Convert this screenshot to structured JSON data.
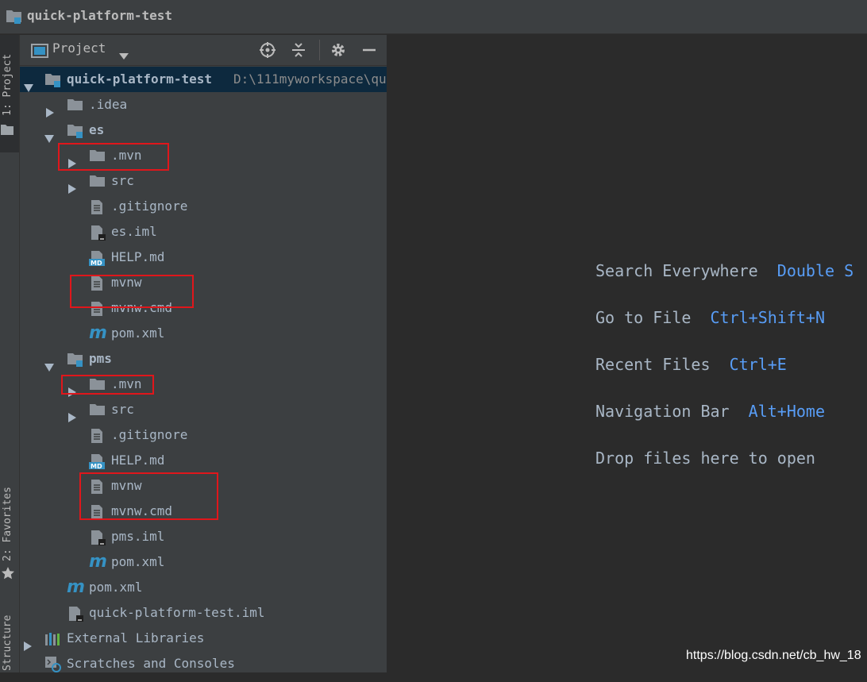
{
  "window": {
    "title": "quick-platform-test"
  },
  "left_strip": {
    "project_tab": "1: Project",
    "favorites_tab": "2: Favorites",
    "structure_tab": "Structure"
  },
  "panel": {
    "title": "Project",
    "icons": [
      "locate-icon",
      "collapse-all-icon",
      "gear-icon",
      "hide-icon"
    ]
  },
  "tree": {
    "root": {
      "name": "quick-platform-test",
      "path": "D:\\111myworkspace\\qu"
    },
    "rows": [
      {
        "label": ".idea"
      },
      {
        "label": "es"
      },
      {
        "label": ".mvn"
      },
      {
        "label": "src"
      },
      {
        "label": ".gitignore"
      },
      {
        "label": "es.iml"
      },
      {
        "label": "HELP.md"
      },
      {
        "label": "mvnw"
      },
      {
        "label": "mvnw.cmd"
      },
      {
        "label": "pom.xml"
      },
      {
        "label": "pms"
      },
      {
        "label": ".mvn"
      },
      {
        "label": "src"
      },
      {
        "label": ".gitignore"
      },
      {
        "label": "HELP.md"
      },
      {
        "label": "mvnw"
      },
      {
        "label": "mvnw.cmd"
      },
      {
        "label": "pms.iml"
      },
      {
        "label": "pom.xml"
      },
      {
        "label": "pom.xml"
      },
      {
        "label": "quick-platform-test.iml"
      },
      {
        "label": "External Libraries"
      },
      {
        "label": "Scratches and Consoles"
      }
    ]
  },
  "editor": {
    "hints": [
      {
        "text": "Search Everywhere",
        "key": "Double S"
      },
      {
        "text": "Go to File",
        "key": "Ctrl+Shift+N"
      },
      {
        "text": "Recent Files",
        "key": "Ctrl+E"
      },
      {
        "text": "Navigation Bar",
        "key": "Alt+Home"
      },
      {
        "text": "Drop files here to open",
        "key": ""
      }
    ]
  },
  "watermark": "https://blog.csdn.net/cb_hw_18",
  "colors": {
    "accent": "#589df6",
    "highlight": "#e0161b",
    "selection": "#0d293e"
  }
}
